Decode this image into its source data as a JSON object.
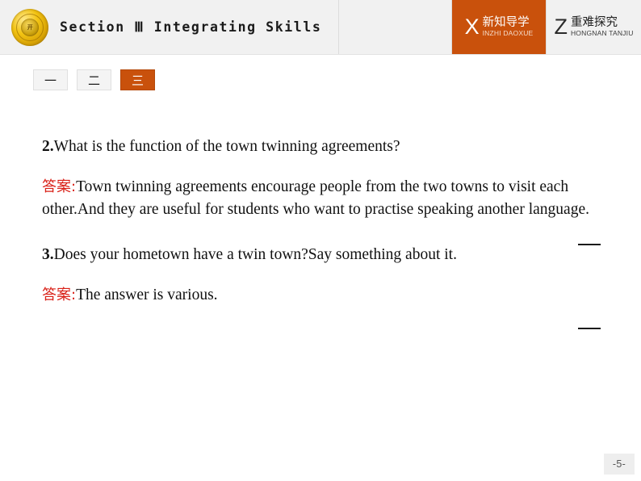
{
  "header": {
    "logo_icon": "gold-seal-logo",
    "logo_mark_text": "开",
    "section_title": "Section Ⅲ  Integrating Skills",
    "tabs": [
      {
        "letter": "X",
        "cn": "新知导学",
        "en": "INZHI DAOXUE",
        "active": true,
        "name": "tab-xinzhi-daoxue"
      },
      {
        "letter": "Z",
        "cn": "重难探究",
        "en": "HONGNAN TANJIU",
        "active": false,
        "name": "tab-zhongnan-tanjiu"
      }
    ]
  },
  "numeral_buttons": [
    {
      "label": "一",
      "active": false
    },
    {
      "label": "二",
      "active": false
    },
    {
      "label": "三",
      "active": true
    }
  ],
  "content": {
    "question_2": {
      "number": "2.",
      "text": "What is the function of the town twinning agreements?"
    },
    "answer_2": {
      "label": "答案:",
      "text": "Town twinning agreements encourage people from the two towns to visit each other.And they are useful for students who want to practise speaking another language."
    },
    "question_3": {
      "number": "3.",
      "text": "Does your hometown have a twin town?Say something about it."
    },
    "answer_3": {
      "label": "答案:",
      "text": "The answer is various."
    }
  },
  "footer": {
    "page_number": "-5-"
  },
  "colors": {
    "accent_orange": "#c9510c",
    "answer_red": "#d91f16",
    "header_bg": "#f1f1f1",
    "gold": "#f3c413"
  }
}
